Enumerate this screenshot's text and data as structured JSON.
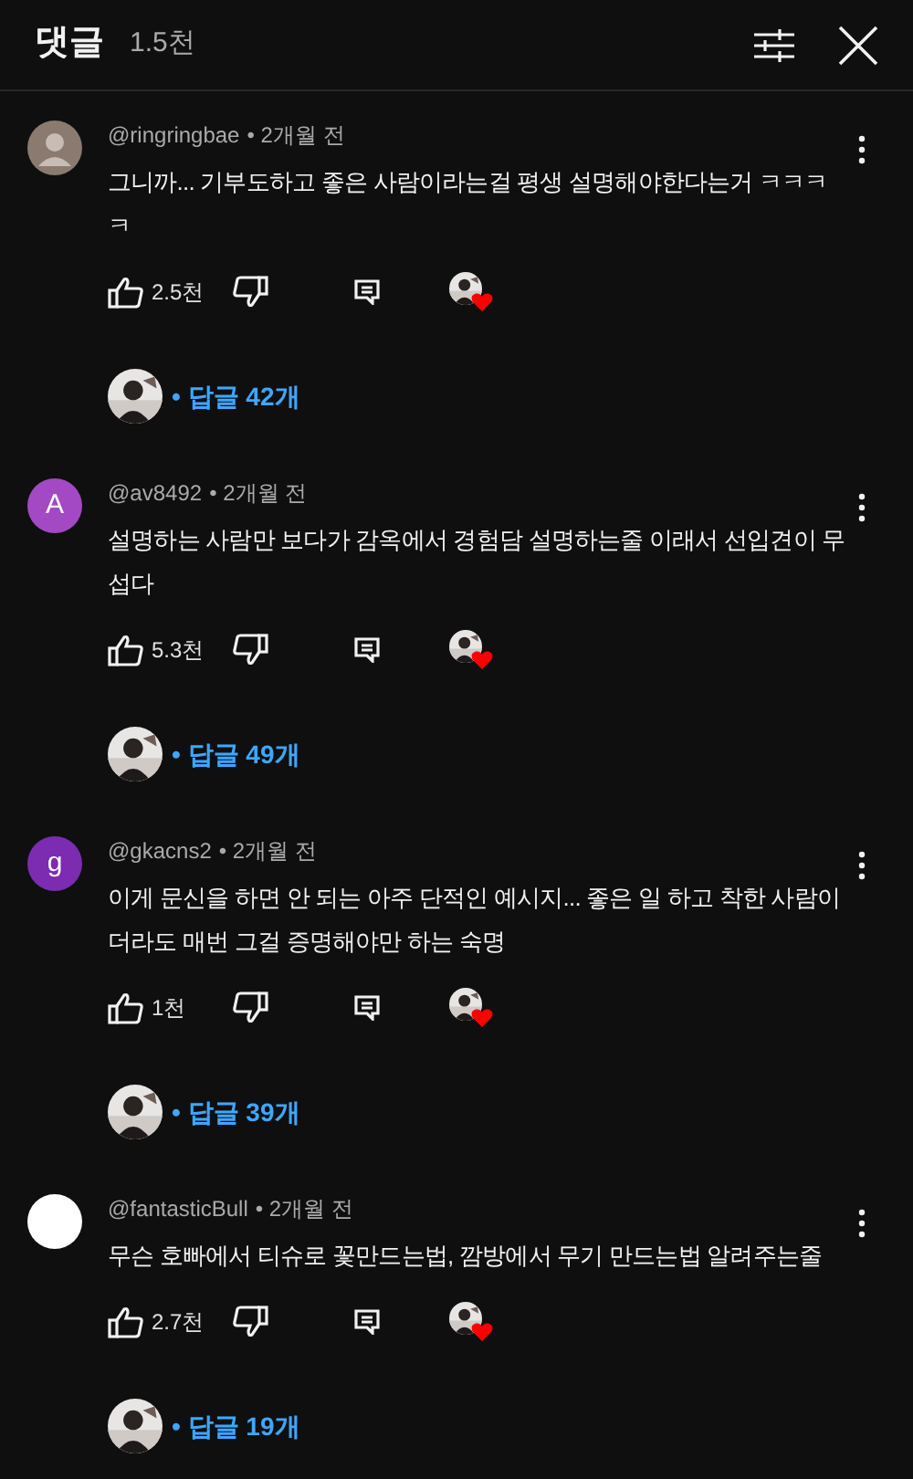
{
  "header": {
    "title": "댓글",
    "count": "1.5천"
  },
  "comments": [
    {
      "avatar": {
        "kind": "silhouette",
        "color": "#8a7a70"
      },
      "author": "@ringringbae",
      "time": "• 2개월 전",
      "text": "그니까... 기부도하고 좋은 사람이라는걸 평생 설명해야한다는거 ㅋㅋㅋㅋ",
      "likes": "2.5천",
      "replies": "• 답글 42개"
    },
    {
      "avatar": {
        "kind": "letter",
        "letter": "A",
        "color": "#a349c4"
      },
      "author": "@av8492",
      "time": "• 2개월 전",
      "text": "설명하는 사람만 보다가 감옥에서 경험담 설명하는줄 이래서 선입견이 무섭다",
      "likes": "5.3천",
      "replies": "• 답글 49개"
    },
    {
      "avatar": {
        "kind": "letter",
        "letter": "g",
        "color": "#7b2cb0"
      },
      "author": "@gkacns2",
      "time": "• 2개월 전",
      "text": "이게 문신을 하면 안 되는 아주 단적인 예시지... 좋은 일 하고 착한 사람이더라도 매번 그걸 증명해야만 하는 숙명",
      "likes": "1천",
      "replies": "• 답글 39개"
    },
    {
      "avatar": {
        "kind": "plain",
        "color": "#ffffff"
      },
      "author": "@fantasticBull",
      "time": "• 2개월 전",
      "text": "무슨 호빠에서 티슈로 꽃만드는법, 깜방에서 무기 만드는법 알려주는줄",
      "likes": "2.7천",
      "replies": "• 답글 19개"
    }
  ]
}
